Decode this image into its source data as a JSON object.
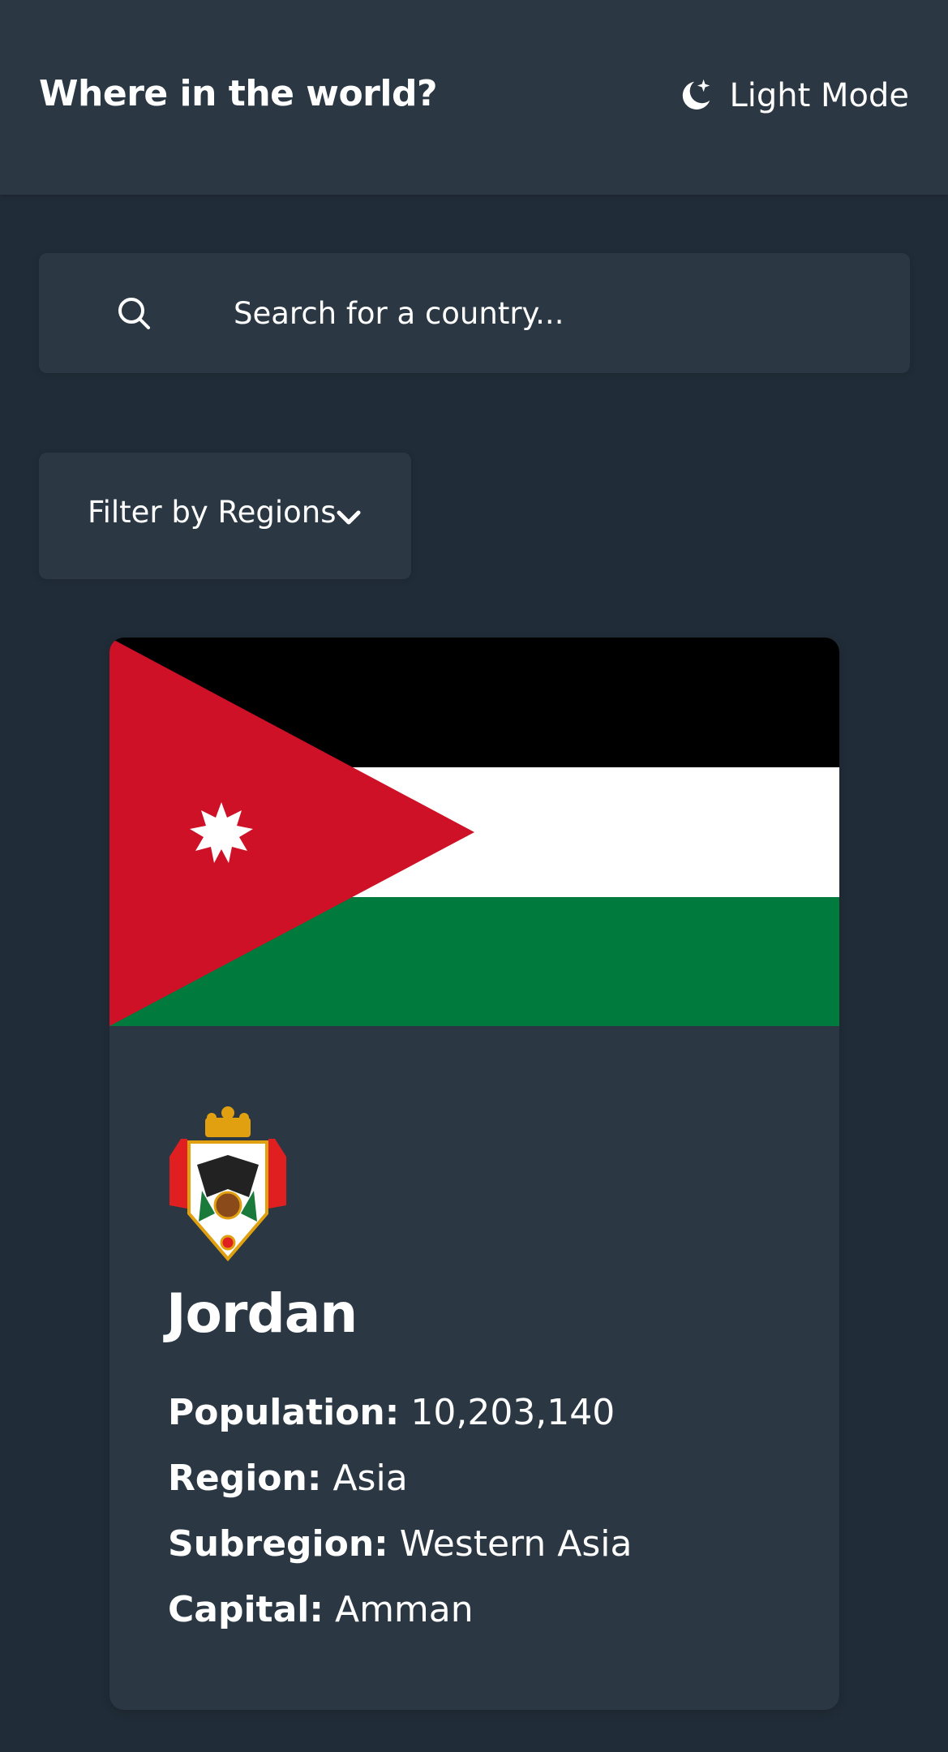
{
  "header": {
    "title": "Where in the world?",
    "theme_toggle_label": "Light Mode",
    "theme_icon": "moon-stars-icon"
  },
  "search": {
    "placeholder": "Search for a country...",
    "icon": "search-icon"
  },
  "filter": {
    "label": "Filter by Regions",
    "icon": "chevron-down-icon"
  },
  "country": {
    "name": "Jordan",
    "flag_image": "flag-of-jordan",
    "coat_of_arms_image": "coat-of-arms-of-jordan",
    "population_label": "Population:",
    "population": "10,203,140",
    "region_label": "Region:",
    "region": "Asia",
    "subregion_label": "Subregion:",
    "subregion": "Western Asia",
    "capital_label": "Capital:",
    "capital": "Amman"
  },
  "colors": {
    "background": "#202c37",
    "surface": "#2b3844",
    "text": "#ffffff",
    "flag_black": "#000000",
    "flag_white": "#ffffff",
    "flag_green": "#007a3d",
    "flag_red": "#ce1126"
  }
}
